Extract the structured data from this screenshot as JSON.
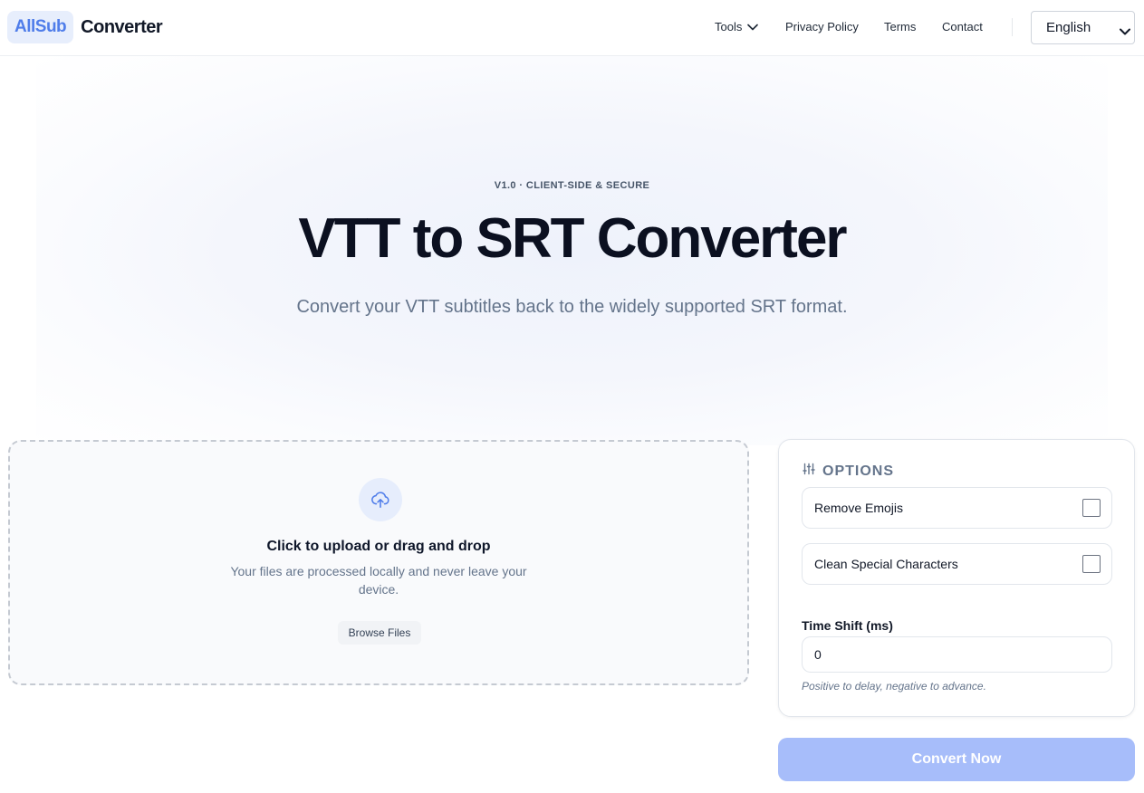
{
  "header": {
    "logo_badge": "AllSub",
    "logo_text": "Converter",
    "nav": {
      "tools": "Tools",
      "privacy": "Privacy Policy",
      "terms": "Terms",
      "contact": "Contact"
    },
    "language": "English"
  },
  "hero": {
    "tag": "V1.0 · CLIENT-SIDE & SECURE",
    "title": "VTT to SRT Converter",
    "subtitle": "Convert your VTT subtitles back to the widely supported SRT format."
  },
  "upload": {
    "title": "Click to upload or drag and drop",
    "description": "Your files are processed locally and never leave your device.",
    "browse_label": "Browse Files",
    "icon": "cloud-upload-icon"
  },
  "options": {
    "title": "OPTIONS",
    "remove_emojis": "Remove Emojis",
    "clean_special": "Clean Special Characters",
    "time_shift_label": "Time Shift (ms)",
    "time_shift_value": "0",
    "time_shift_help": "Positive to delay, negative to advance."
  },
  "convert_label": "Convert Now",
  "colors": {
    "accent": "#4f7dea",
    "button_disabled": "#a7bdfa"
  }
}
